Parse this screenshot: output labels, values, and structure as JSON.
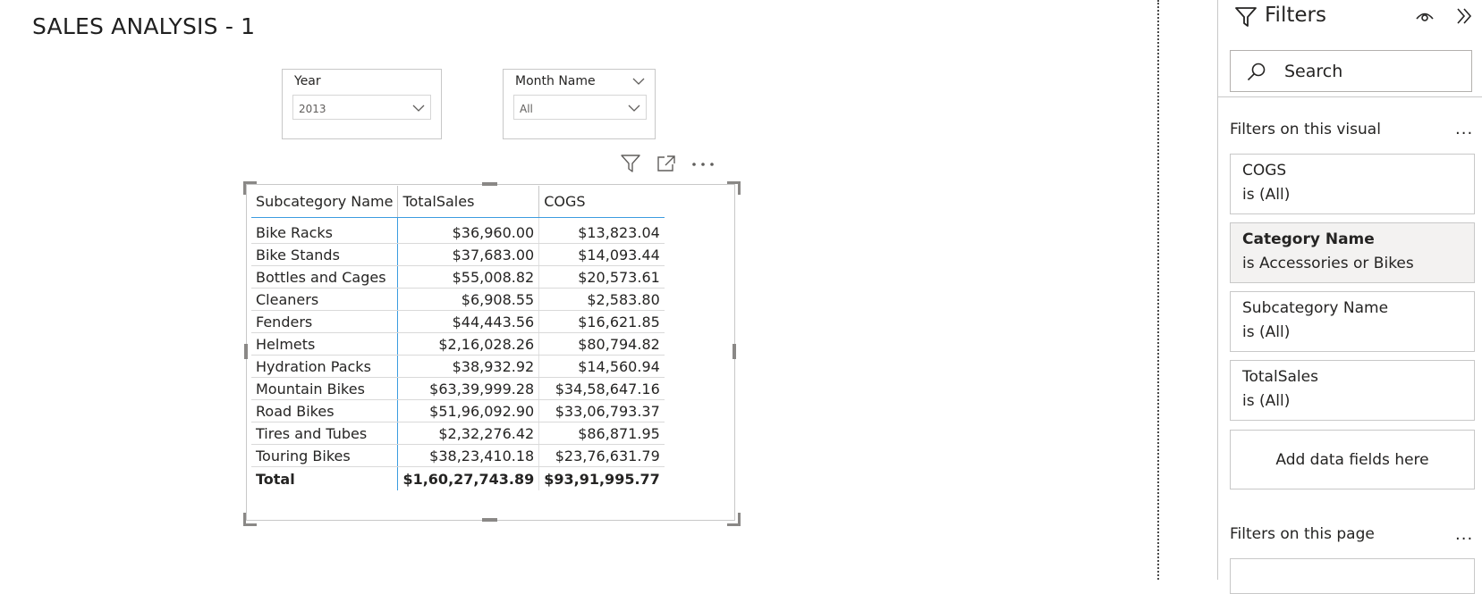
{
  "report": {
    "title": "SALES ANALYSIS - 1"
  },
  "slicers": [
    {
      "title": "Year",
      "value": "2013"
    },
    {
      "title": "Month Name",
      "value": "All"
    }
  ],
  "table": {
    "headers": [
      "Subcategory Name",
      "TotalSales",
      "COGS"
    ],
    "rows": [
      [
        "Bike Racks",
        "$36,960.00",
        "$13,823.04"
      ],
      [
        "Bike Stands",
        "$37,683.00",
        "$14,093.44"
      ],
      [
        "Bottles and Cages",
        "$55,008.82",
        "$20,573.61"
      ],
      [
        "Cleaners",
        "$6,908.55",
        "$2,583.80"
      ],
      [
        "Fenders",
        "$44,443.56",
        "$16,621.85"
      ],
      [
        "Helmets",
        "$2,16,028.26",
        "$80,794.82"
      ],
      [
        "Hydration Packs",
        "$38,932.92",
        "$14,560.94"
      ],
      [
        "Mountain Bikes",
        "$63,39,999.28",
        "$34,58,647.16"
      ],
      [
        "Road Bikes",
        "$51,96,092.90",
        "$33,06,793.37"
      ],
      [
        "Tires and Tubes",
        "$2,32,276.42",
        "$86,871.95"
      ],
      [
        "Touring Bikes",
        "$38,23,410.18",
        "$23,76,631.79"
      ]
    ],
    "total": [
      "Total",
      "$1,60,27,743.89",
      "$93,91,995.77"
    ]
  },
  "visual_header_icons": [
    "filter-icon",
    "focus-mode-icon",
    "more-options-icon"
  ],
  "filters_pane": {
    "title": "Filters",
    "search_placeholder": "Search",
    "section_visual": "Filters on this visual",
    "section_page": "Filters on this page",
    "more_label": "...",
    "cards": [
      {
        "name": "COGS",
        "value": "is (All)",
        "active": false
      },
      {
        "name": "Category Name",
        "value": "is Accessories or Bikes",
        "active": true
      },
      {
        "name": "Subcategory Name",
        "value": "is (All)",
        "active": false
      },
      {
        "name": "TotalSales",
        "value": "is (All)",
        "active": false
      }
    ],
    "add_fields_label": "Add data fields here"
  },
  "colors": {
    "accent_line": "#3c9ce0",
    "active_card": "#f3f2f1",
    "border": "#c8c8c8"
  }
}
